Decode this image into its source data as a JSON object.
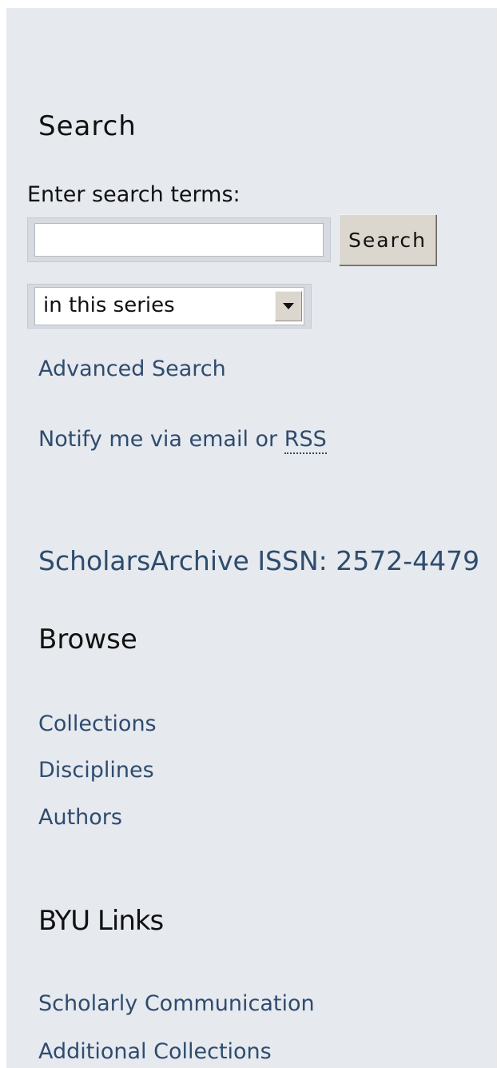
{
  "search": {
    "heading": "Search",
    "label": "Enter search terms:",
    "input_value": "",
    "button_label": "Search",
    "scope_selected": "in this series",
    "advanced_link": "Advanced Search",
    "notify_text": "Notify me via email or ",
    "rss_label": "RSS"
  },
  "issn": {
    "label": "ScholarsArchive ISSN: 2572-4479"
  },
  "browse": {
    "heading": "Browse",
    "items": [
      {
        "label": "Collections"
      },
      {
        "label": "Disciplines"
      },
      {
        "label": "Authors"
      }
    ]
  },
  "byu_links": {
    "heading": "BYU Links",
    "items": [
      {
        "label": "Scholarly Communication"
      },
      {
        "label": "Additional Collections"
      }
    ]
  },
  "colors": {
    "sidebar_bg": "#e6e9ee",
    "link": "#2e4c6e",
    "button_bg": "#dcd7ce"
  }
}
